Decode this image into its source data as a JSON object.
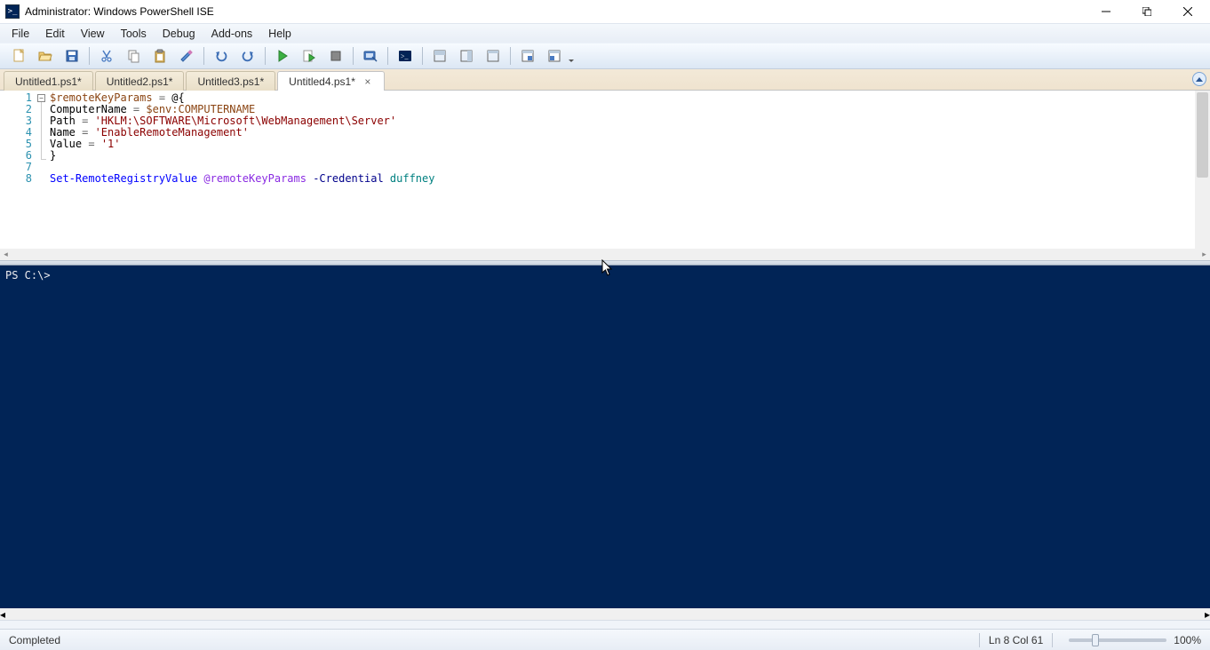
{
  "window": {
    "title": "Administrator: Windows PowerShell ISE"
  },
  "menu": [
    "File",
    "Edit",
    "View",
    "Tools",
    "Debug",
    "Add-ons",
    "Help"
  ],
  "tabs": [
    {
      "label": "Untitled1.ps1*"
    },
    {
      "label": "Untitled2.ps1*"
    },
    {
      "label": "Untitled3.ps1*"
    },
    {
      "label": "Untitled4.ps1*",
      "active": true
    }
  ],
  "code_lines": [
    "1",
    "2",
    "3",
    "4",
    "5",
    "6",
    "7",
    "8"
  ],
  "code": {
    "l1_var": "$remoteKeyParams",
    "l1_op": " = ",
    "l1_rest": "@{",
    "l2_key": "ComputerName ",
    "l2_op": "= ",
    "l2_val": "$env:COMPUTERNAME",
    "l3_key": "Path ",
    "l3_op": "= ",
    "l3_val": "'HKLM:\\SOFTWARE\\Microsoft\\WebManagement\\Server'",
    "l4_key": "Name ",
    "l4_op": "= ",
    "l4_val": "'EnableRemoteManagement'",
    "l5_key": "Value ",
    "l5_op": "= ",
    "l5_val": "'1'",
    "l6": "}",
    "l7": "",
    "l8_cmd": "Set-RemoteRegistryValue ",
    "l8_spl": "@remoteKeyParams",
    "l8_par": " -Credential ",
    "l8_id": "duffney"
  },
  "console": {
    "prompt": "PS C:\\> "
  },
  "status": {
    "msg": "Completed",
    "pos": "Ln 8  Col 61",
    "zoom": "100%"
  }
}
